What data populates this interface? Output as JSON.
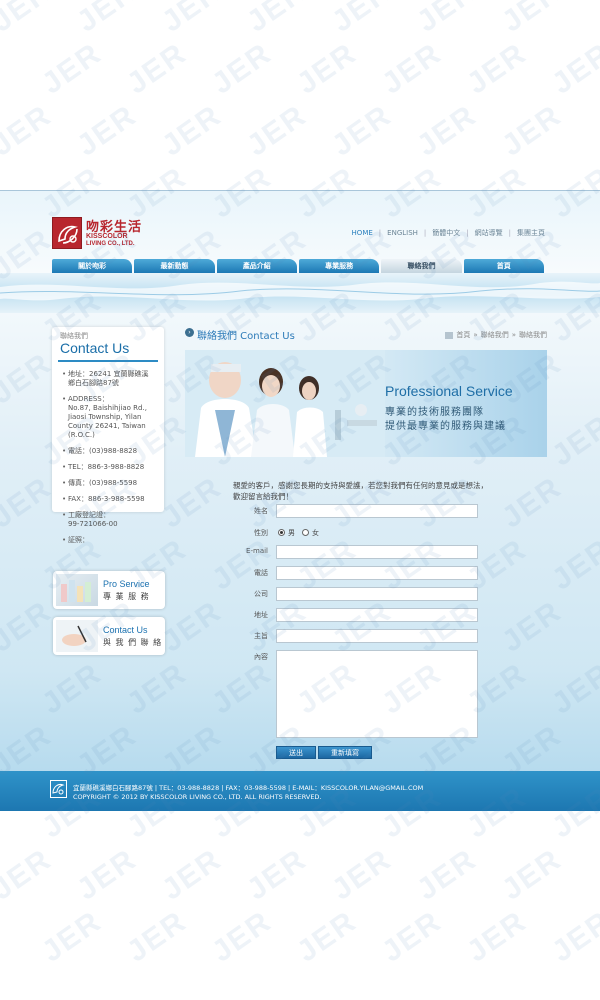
{
  "logo": {
    "cn": "吻彩生活",
    "en_line1": "KISSCOLOR",
    "en_line2": "LIVING CO., LTD."
  },
  "toplinks": [
    "HOME",
    "ENGLISH",
    "簡體中文",
    "網站導覽",
    "集團主頁"
  ],
  "nav": [
    "關於吻彩",
    "最新動態",
    "產品介紹",
    "專業服務",
    "聯絡我們",
    "首頁"
  ],
  "nav_active_index": 4,
  "sidebar": {
    "small_title": "聯絡我們",
    "title": "Contact Us",
    "items": [
      {
        "label": "地址：26241 宜蘭縣礁溪",
        "sub": "鄉白石腳路87號"
      },
      {
        "label": "ADDRESS：",
        "sub": "No.87, Baishihjiao Rd., Jiaosi Township, Yilan County 26241, Taiwan (R.O.C.)"
      },
      {
        "label": "電話：(03)988-8828",
        "sub": ""
      },
      {
        "label": "TEL：886-3-988-8828",
        "sub": ""
      },
      {
        "label": "傳真：(03)988-5598",
        "sub": ""
      },
      {
        "label": "FAX：886-3-988-5598",
        "sub": ""
      },
      {
        "label": "工廠登記證：",
        "sub": "99-721066-00"
      },
      {
        "label": "証照：",
        "sub": ""
      }
    ],
    "banner1": {
      "en": "Pro Service",
      "cn": "專 業 服 務"
    },
    "banner2": {
      "en": "Contact Us",
      "cn": "與 我 們 聯 絡"
    }
  },
  "content": {
    "title": "聯絡我們 Contact Us",
    "breadcrumb": [
      "首頁",
      "»",
      "聯絡我們",
      "»",
      "聯絡我們"
    ],
    "hero": {
      "title": "Professional Service",
      "line1": "專業的技術服務團隊",
      "line2": "提供最專業的服務與建議"
    },
    "intro": "親愛的客戶，感謝您長期的支持與愛護，若您對我們有任何的意見或是想法，歡迎留言給我們！",
    "form": {
      "name_label": "姓名",
      "gender_label": "性別",
      "gender_male": "男",
      "gender_female": "女",
      "gender_selected": "男",
      "email_label": "E-mail",
      "phone_label": "電話",
      "company_label": "公司",
      "address_label": "地址",
      "subject_label": "主旨",
      "content_label": "內容",
      "submit_label": "送出",
      "reset_label": "重新填寫"
    }
  },
  "footer": {
    "line1": "宜蘭縣礁溪鄉白石腳路87號 | TEL：03-988-8828 | FAX：03-988-5598 | E-MAIL：KISSCOLOR.YILAN@GMAIL.COM",
    "line2": "COPYRIGHT © 2012 BY KISSCOLOR LIVING CO., LTD. ALL RIGHTS RESERVED."
  },
  "watermark": "JER",
  "colors": {
    "brand_red": "#b8262e",
    "accent_blue": "#2a7fbe",
    "nav_blue": "#1c78b4",
    "footer_blue": "#1d77b1"
  }
}
